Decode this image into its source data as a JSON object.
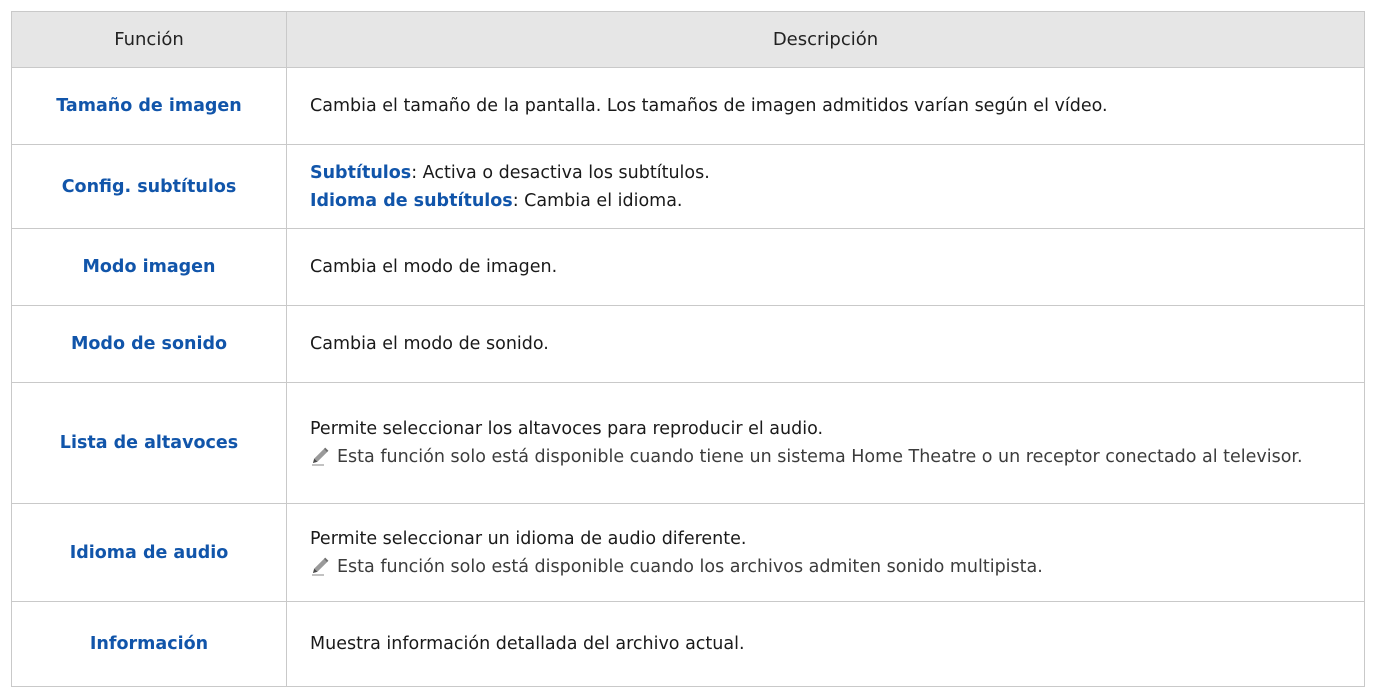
{
  "header": {
    "col1": "Función",
    "col2": "Descripción"
  },
  "rows": [
    {
      "function": "Tamaño de imagen",
      "description": "Cambia el tamaño de la pantalla. Los tamaños de imagen admitidos varían según el vídeo."
    },
    {
      "function": "Config. subtítulos",
      "items": [
        {
          "term": "Subtítulos",
          "text": ": Activa o desactiva los subtítulos."
        },
        {
          "term": "Idioma de subtítulos",
          "text": ": Cambia el idioma."
        }
      ]
    },
    {
      "function": "Modo imagen",
      "description": "Cambia el modo de imagen."
    },
    {
      "function": "Modo de sonido",
      "description": "Cambia el modo de sonido."
    },
    {
      "function": "Lista de altavoces",
      "description": "Permite seleccionar los altavoces para reproducir el audio.",
      "note": "Esta función solo está disponible cuando tiene un sistema Home Theatre o un receptor conectado al televisor."
    },
    {
      "function": "Idioma de audio",
      "description": "Permite seleccionar un idioma de audio diferente.",
      "note": "Esta función solo está disponible cuando los archivos admiten sonido multipista."
    },
    {
      "function": "Información",
      "description": "Muestra información detallada del archivo actual."
    }
  ],
  "icons": {
    "note": "pencil-note-icon"
  },
  "colors": {
    "accent": "#1155aa",
    "header_bg": "#e6e6e6",
    "border": "#c9c9c9"
  }
}
